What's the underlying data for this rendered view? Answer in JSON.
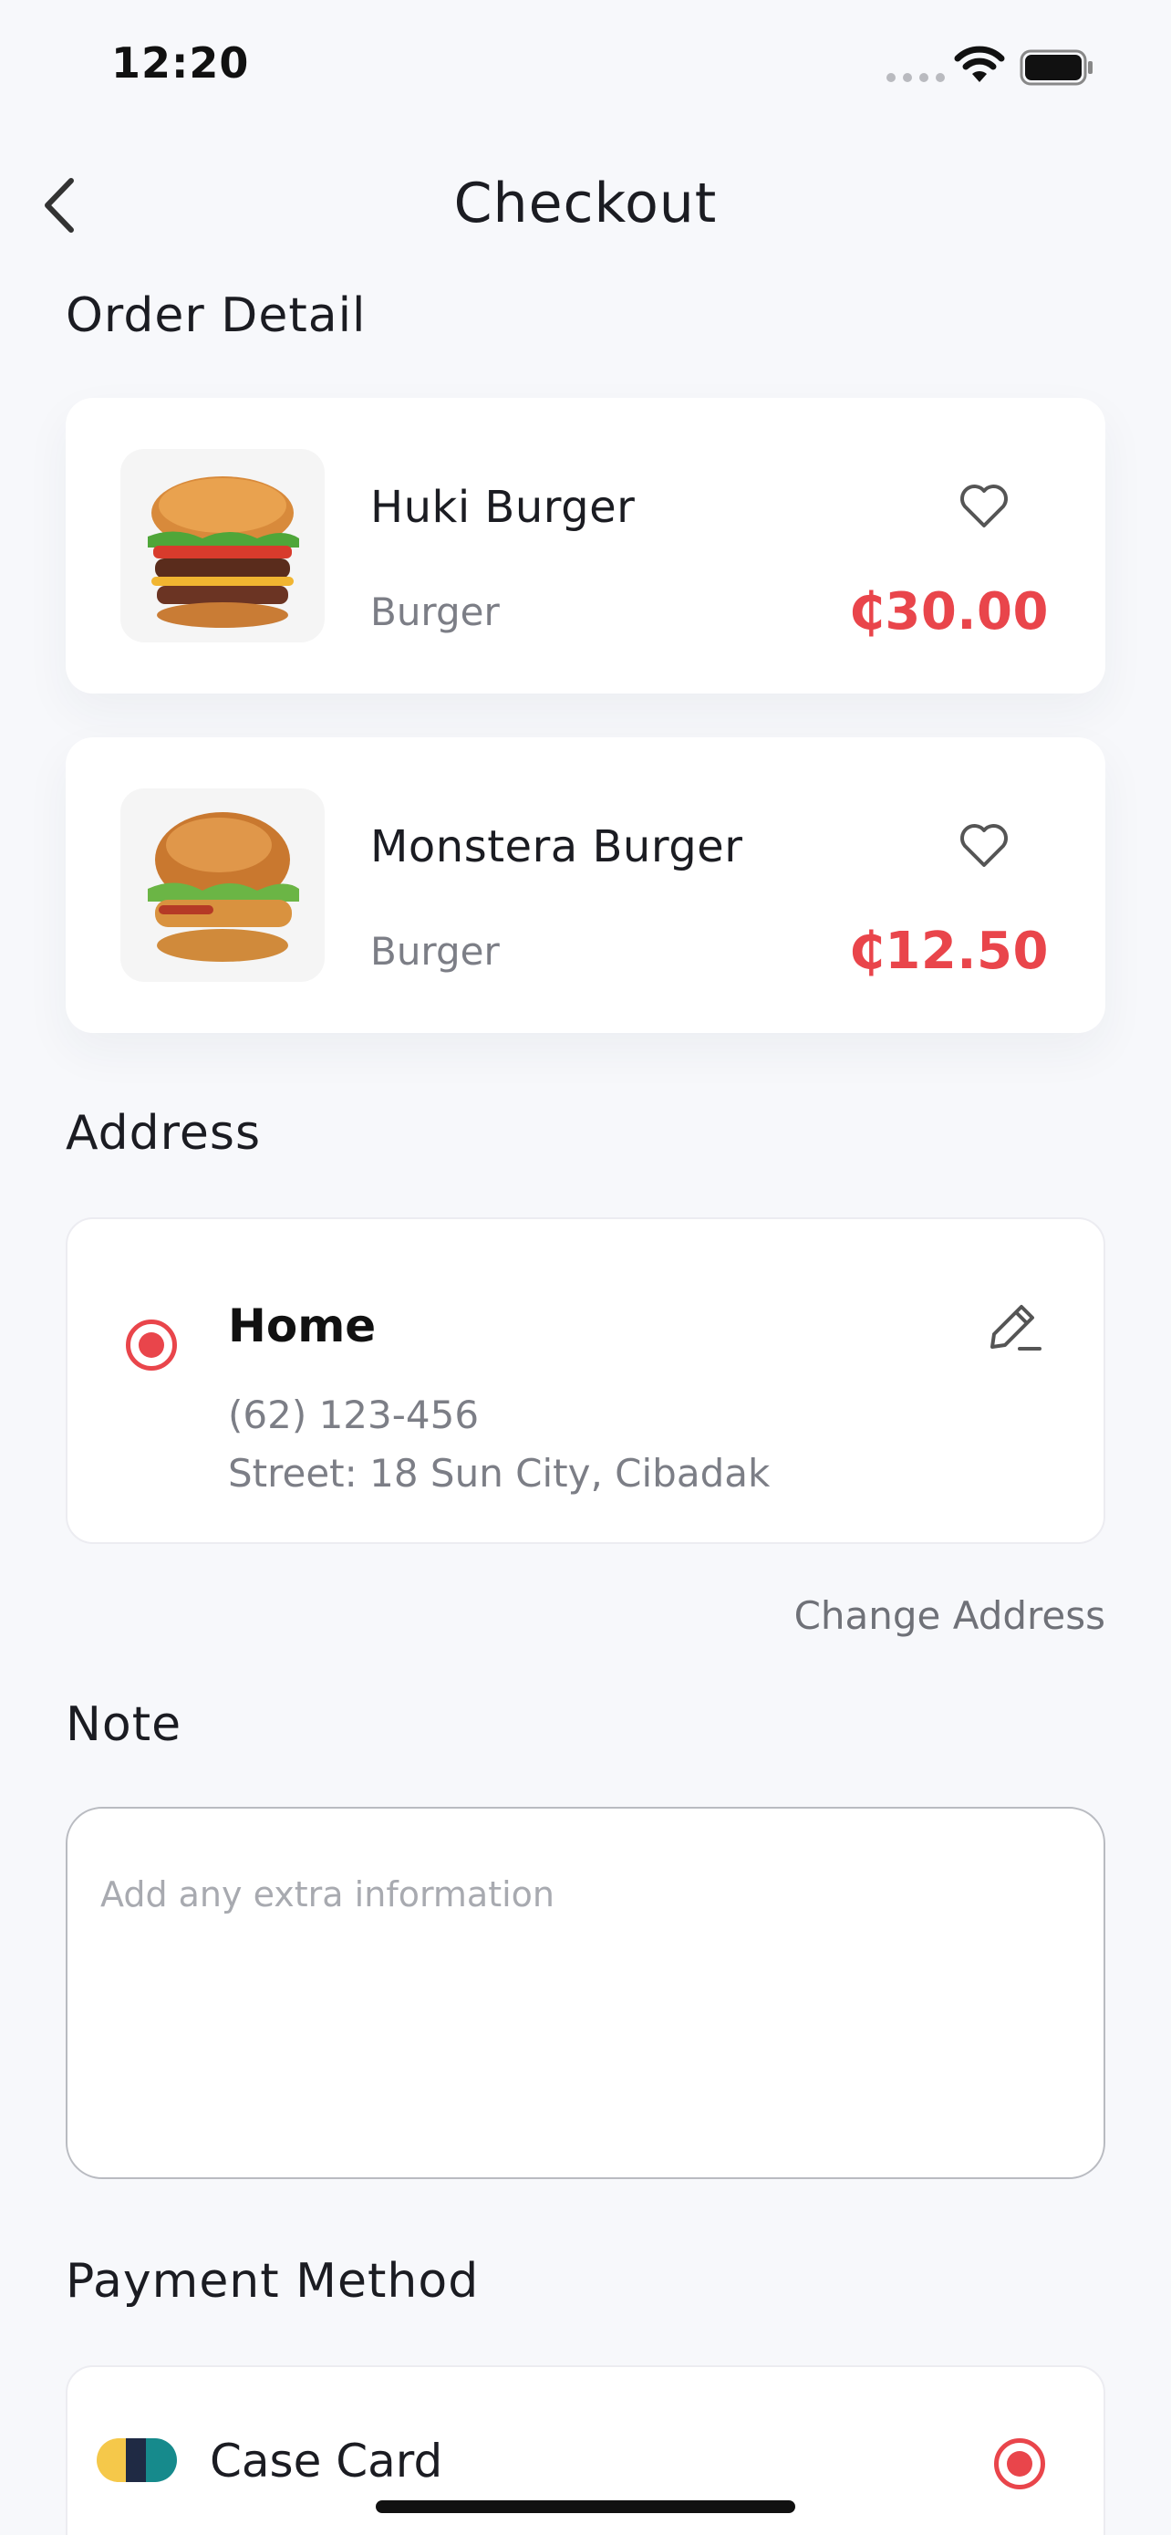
{
  "status_bar": {
    "time": "12:20"
  },
  "header": {
    "title": "Checkout"
  },
  "order_detail": {
    "title": "Order Detail",
    "items": [
      {
        "name": "Huki Burger",
        "category": "Burger",
        "price": "₵30.00",
        "image": "burger-photo"
      },
      {
        "name": "Monstera Burger",
        "category": "Burger",
        "price": "₵12.50",
        "image": "burger-photo"
      }
    ]
  },
  "address": {
    "title": "Address",
    "label": "Home",
    "phone": "(62) 123-456",
    "street": "Street: 18 Sun City, Cibadak",
    "change_link": "Change Address"
  },
  "note": {
    "title": "Note",
    "placeholder": "Add any extra information",
    "value": ""
  },
  "payment": {
    "title": "Payment Method",
    "selected_method": "Case Card"
  },
  "colors": {
    "accent": "#e9454b",
    "background": "#f7f8fb",
    "text": "#1b1c22",
    "muted": "#7c7e86"
  }
}
